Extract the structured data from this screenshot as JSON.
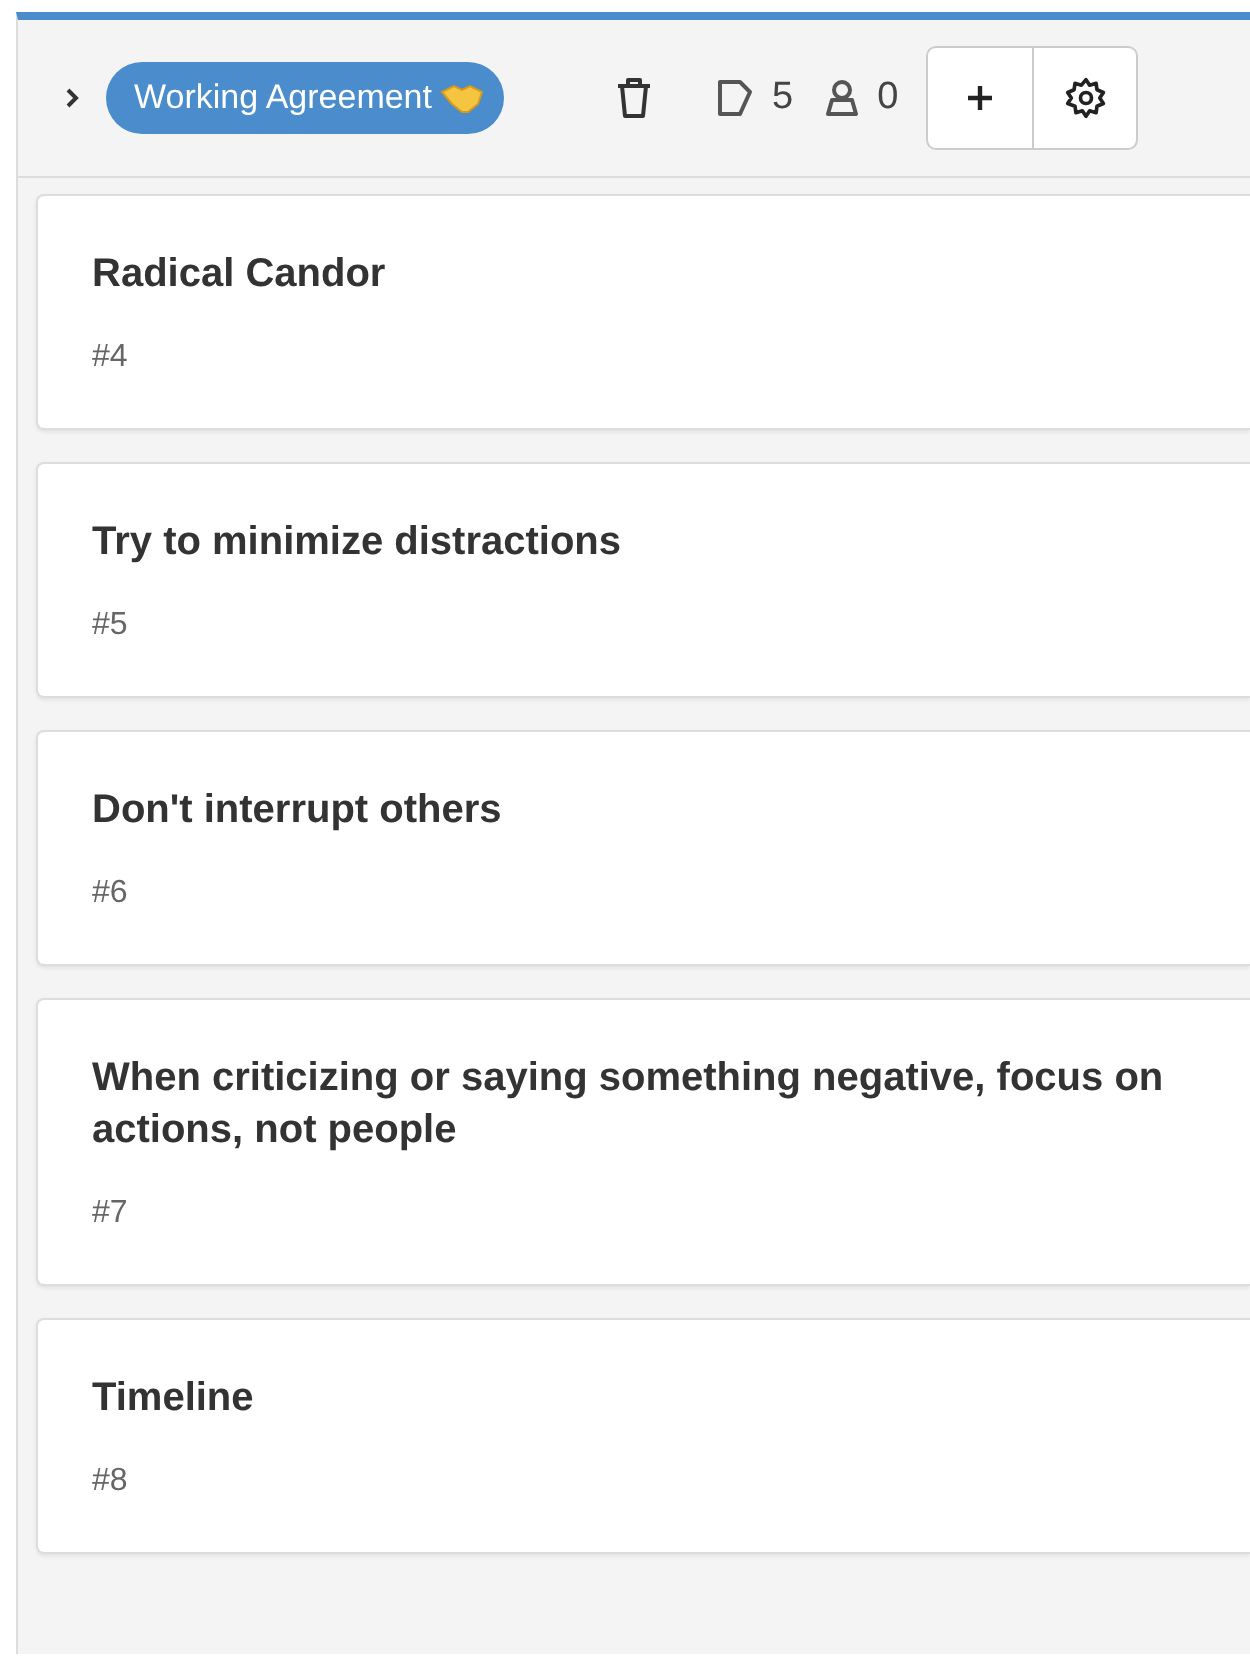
{
  "list": {
    "title": "Working Agreement",
    "expanded": false,
    "card_count": "5",
    "member_count": "0"
  },
  "cards": [
    {
      "title": "Radical Candor",
      "number": "#4"
    },
    {
      "title": "Try to minimize distractions",
      "number": "#5"
    },
    {
      "title": "Don't interrupt others",
      "number": "#6"
    },
    {
      "title": "When criticizing or saying something negative, focus on actions, not people",
      "number": "#7"
    },
    {
      "title": "Timeline",
      "number": "#8"
    }
  ]
}
